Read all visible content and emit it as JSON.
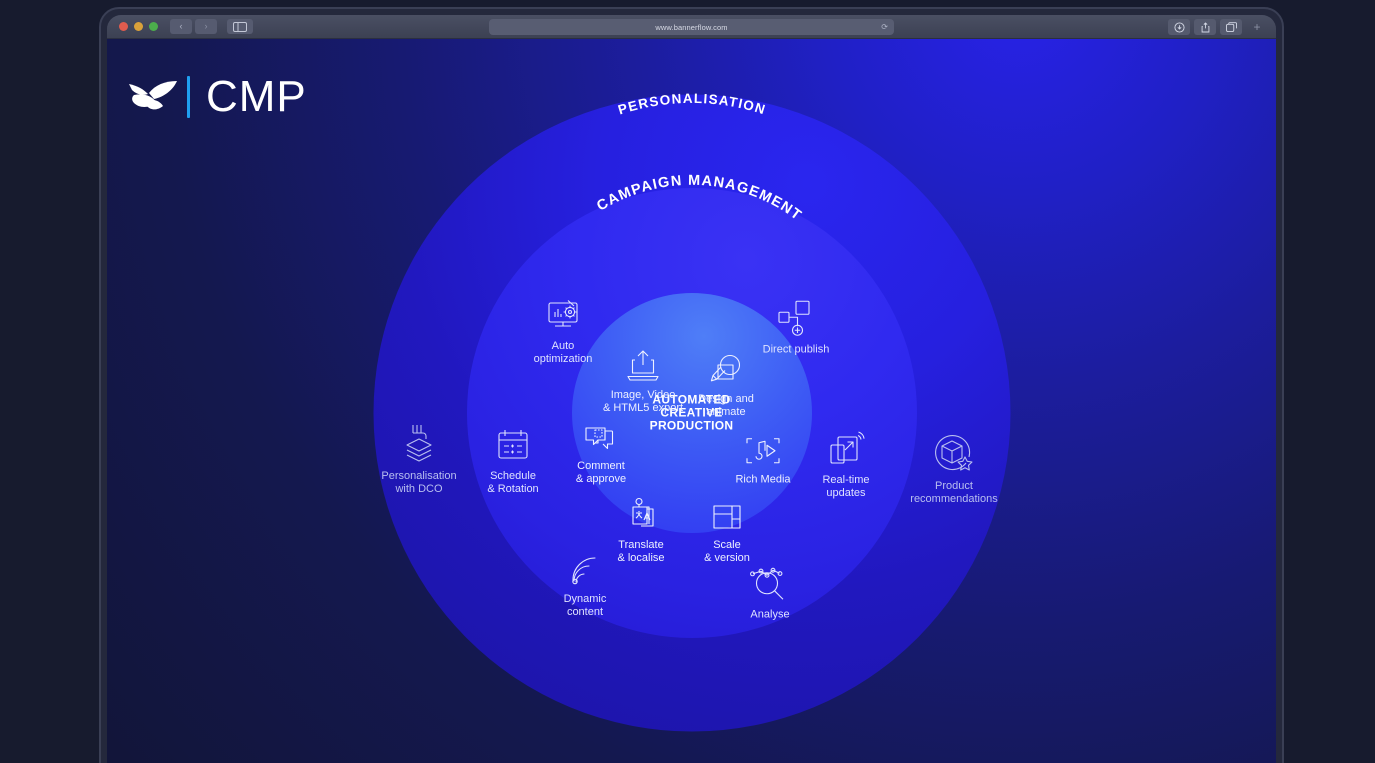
{
  "browser": {
    "url": "www.bannerflow.com",
    "back_label": "‹",
    "forward_label": "›",
    "reload_label": "⟳",
    "new_tab_label": "+",
    "sidebar_icon": "sidebar-icon",
    "download_icon": "download-icon",
    "share_icon": "share-icon",
    "tabs_icon": "tabs-icon"
  },
  "logo": {
    "mark": "butterfly-logo",
    "word": "CMP"
  },
  "rings": {
    "outer_label": "PERSONALISATION",
    "mid_label": "CAMPAIGN MANAGEMENT",
    "inner_label": "AUTOMATED\nCREATIVE\nPRODUCTION",
    "outer_color": "#2620df",
    "mid_color": "#302af0",
    "inner_color": "#3f5ff5",
    "background_color": "#171b2e"
  },
  "features": {
    "outer": [
      {
        "icon": "layers-dco-icon",
        "label": "Personalisation\nwith DCO"
      },
      {
        "icon": "product-box-star-icon",
        "label": "Product\nrecommendations"
      }
    ],
    "middle": [
      {
        "icon": "auto-optimization-icon",
        "label": "Auto\noptimization"
      },
      {
        "icon": "direct-publish-icon",
        "label": "Direct publish"
      },
      {
        "icon": "calendar-icon",
        "label": "Schedule\n& Rotation"
      },
      {
        "icon": "real-time-updates-icon",
        "label": "Real-time\nupdates"
      },
      {
        "icon": "dynamic-content-icon",
        "label": "Dynamic\ncontent"
      },
      {
        "icon": "analyse-icon",
        "label": "Analyse"
      }
    ],
    "inner": [
      {
        "icon": "export-upload-icon",
        "label": "Image, Video\n& HTML5 export"
      },
      {
        "icon": "design-animate-icon",
        "label": "Design and\nanimate"
      },
      {
        "icon": "comment-approve-icon",
        "label": "Comment\n& approve"
      },
      {
        "icon": "rich-media-icon",
        "label": "Rich Media"
      },
      {
        "icon": "translate-localise-icon",
        "label": "Translate\n& localise"
      },
      {
        "icon": "scale-version-icon",
        "label": "Scale\n& version"
      }
    ]
  }
}
